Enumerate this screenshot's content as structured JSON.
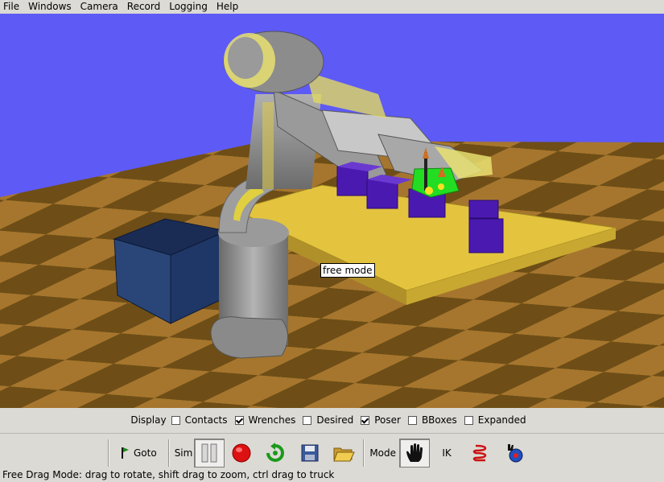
{
  "menu": {
    "items": [
      "File",
      "Windows",
      "Camera",
      "Record",
      "Logging",
      "Help"
    ]
  },
  "viewport": {
    "tooltip": "free mode",
    "colors": {
      "sky": "#5e5af5",
      "floor_light": "#a6762e",
      "floor_dark": "#6e4e16",
      "table": "#e4c43e",
      "blocks": "#4a1ab0",
      "bin": "#223c6e",
      "robot": "#8e8e8e",
      "gripper_highlight": "#22dd22"
    }
  },
  "display": {
    "label": "Display",
    "options": [
      {
        "label": "Contacts",
        "checked": false
      },
      {
        "label": "Wrenches",
        "checked": true
      },
      {
        "label": "Desired",
        "checked": false
      },
      {
        "label": "Poser",
        "checked": true
      },
      {
        "label": "BBoxes",
        "checked": false
      },
      {
        "label": "Expanded",
        "checked": false
      }
    ]
  },
  "toolbar": {
    "goto_label": "Goto",
    "sim_label": "Sim",
    "mode_label": "Mode",
    "ik_label": "IK",
    "icons": [
      "goto-flag-icon",
      "pause-icon",
      "record-icon",
      "reset-icon",
      "save-icon",
      "open-folder-icon",
      "hand-icon",
      "spring-icon",
      "force-icon"
    ]
  },
  "status": {
    "text": "Free Drag Mode: drag to rotate, shift drag to zoom, ctrl drag to truck"
  }
}
